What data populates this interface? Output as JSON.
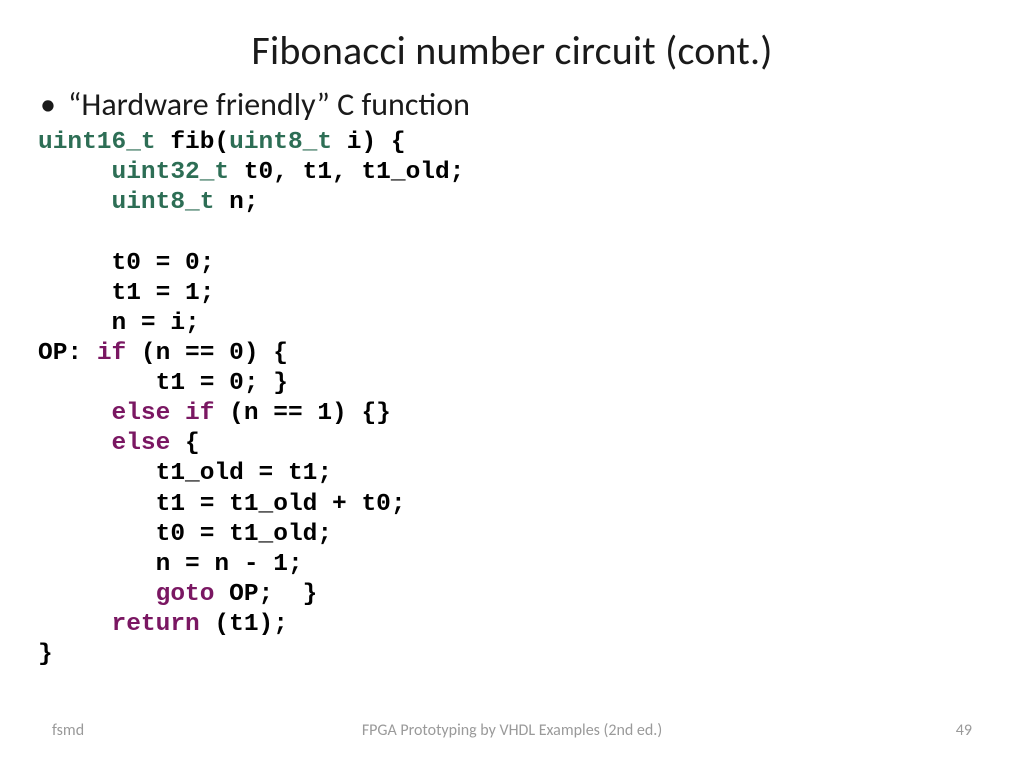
{
  "title": "Fibonacci number circuit (cont.)",
  "bullet_text": "“Hardware friendly” C function",
  "code": {
    "l01a": "uint16_t",
    "l01b": " fib(",
    "l01c": "uint8_t",
    "l01d": " i) {",
    "l02a": "     ",
    "l02b": "uint32_t",
    "l02c": " t0, t1, t1_old;",
    "l03a": "     ",
    "l03b": "uint8_t",
    "l03c": " n;",
    "blank1": " ",
    "l04": "     t0 = 0;",
    "l05": "     t1 = 1;",
    "l06": "     n = i;",
    "l07a": "OP: ",
    "l07b": "if",
    "l07c": " (n == 0) {",
    "l08": "        t1 = 0; }",
    "l09a": "     ",
    "l09b": "else if",
    "l09c": " (n == 1) {}",
    "l10a": "     ",
    "l10b": "else",
    "l10c": " {",
    "l11": "        t1_old = t1;",
    "l12": "        t1 = t1_old + t0;",
    "l13": "        t0 = t1_old;",
    "l14": "        n = n - 1;",
    "l15a": "        ",
    "l15b": "goto",
    "l15c": " OP;  }",
    "l16a": "     ",
    "l16b": "return",
    "l16c": " (t1);",
    "l17": "}"
  },
  "footer": {
    "left": "fsmd",
    "center": "FPGA Prototyping by VHDL Examples (2nd ed.)",
    "page": "49"
  }
}
